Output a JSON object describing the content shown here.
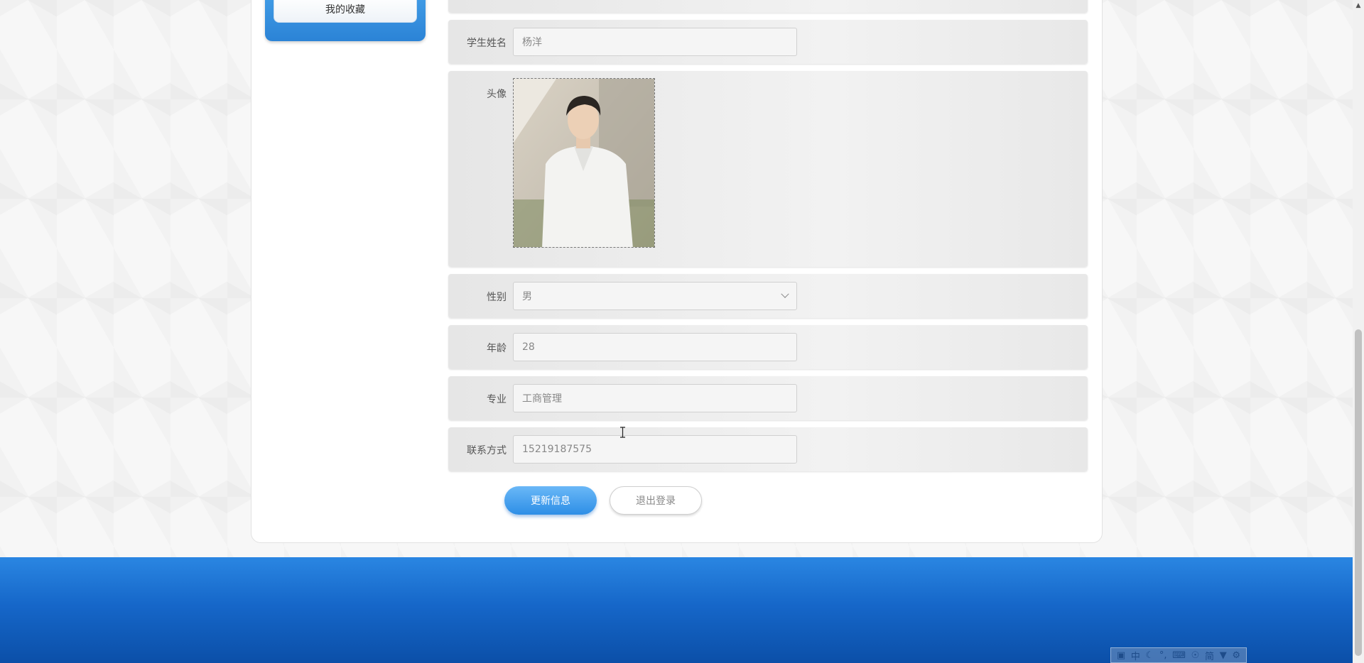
{
  "sidebar": {
    "item_label": "我的收藏"
  },
  "form": {
    "name": {
      "label": "学生姓名",
      "value": "杨洋"
    },
    "avatar": {
      "label": "头像"
    },
    "gender": {
      "label": "性别",
      "value": "男"
    },
    "age": {
      "label": "年龄",
      "value": "28"
    },
    "major": {
      "label": "专业",
      "value": "工商管理"
    },
    "contact": {
      "label": "联系方式",
      "value": "15219187575"
    }
  },
  "buttons": {
    "update_label": "更新信息",
    "logout_label": "退出登录"
  },
  "ime": {
    "mode_label": "中",
    "simplified_label": "简"
  },
  "colors": {
    "primary": "#2d8ee6",
    "footer": "#1667c9"
  }
}
